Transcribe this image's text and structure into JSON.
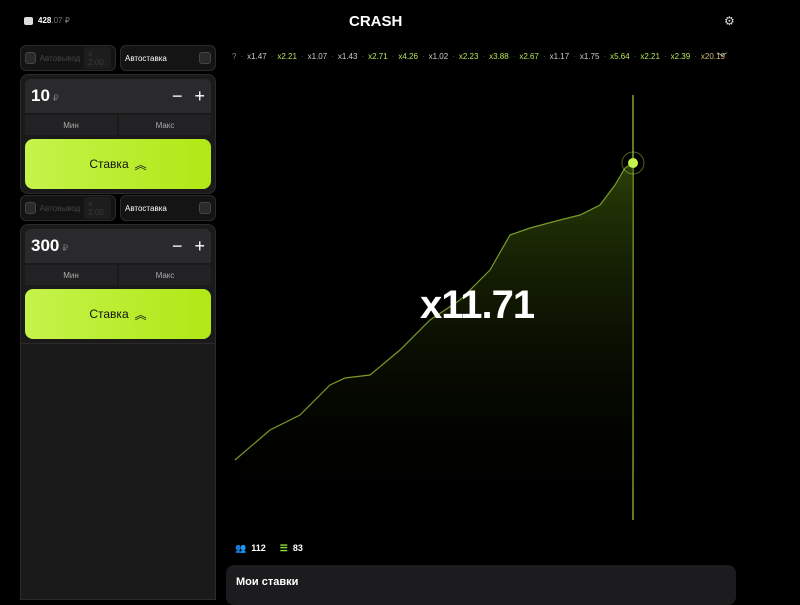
{
  "header": {
    "balance": "428",
    "balance_cents": ".07 ₽",
    "logo": "CRASH",
    "icons": [
      "wallet-icon",
      "gear-icon"
    ]
  },
  "bets": [
    {
      "autowithdraw_label": "Автовывод",
      "autowithdraw_value": "x 2.00",
      "autobet_label": "Автоставка",
      "amount": "10",
      "currency": "₽",
      "minus": "−",
      "plus": "+",
      "min_label": "Мин",
      "max_label": "Макс",
      "bet_label": "Ставка"
    },
    {
      "autowithdraw_label": "Автовывод",
      "autowithdraw_value": "x 2.00",
      "autobet_label": "Автоставка",
      "amount": "300",
      "currency": "₽",
      "minus": "−",
      "plus": "+",
      "min_label": "Мин",
      "max_label": "Макс",
      "bet_label": "Ставка"
    }
  ],
  "history": [
    "x1.47",
    "x2.21",
    "x1.07",
    "x1.43",
    "x2.71",
    "x4.26",
    "x1.02",
    "x2.23",
    "x3.88",
    "x2.67",
    "x1.17",
    "x1.75",
    "x5.64",
    "x2.21",
    "x2.39",
    "x20.19"
  ],
  "game": {
    "multiplier": "x11.71",
    "accent": "#c5f34b"
  },
  "stats": {
    "players": "112",
    "bets": "83"
  },
  "my_bets": {
    "title": "Мои ставки"
  }
}
